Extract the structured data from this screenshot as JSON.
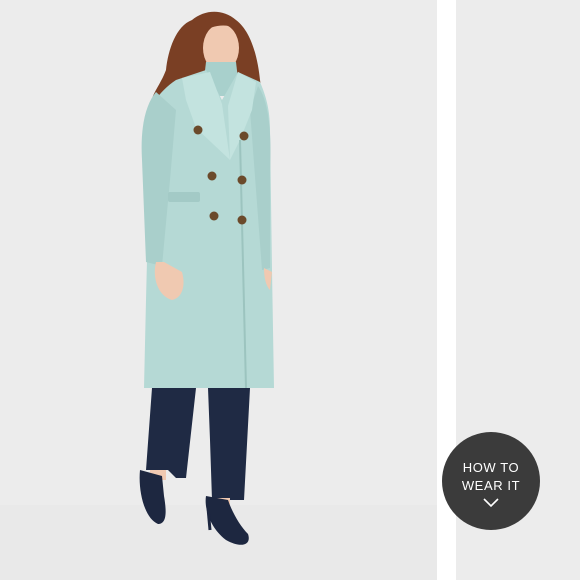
{
  "image": {
    "subject": "model-in-coat-photo",
    "colors": {
      "background": "#ececec",
      "coat": "#b5d9d5",
      "pants": "#1f2a44",
      "shoes": "#1d2740",
      "buttons": "#6b4a2b",
      "hair": "#7a3f24"
    }
  },
  "how_to_wear": {
    "line1": "HOW TO",
    "line2": "WEAR IT",
    "icon": "chevron-down-icon",
    "background": "#3b3b3b"
  }
}
